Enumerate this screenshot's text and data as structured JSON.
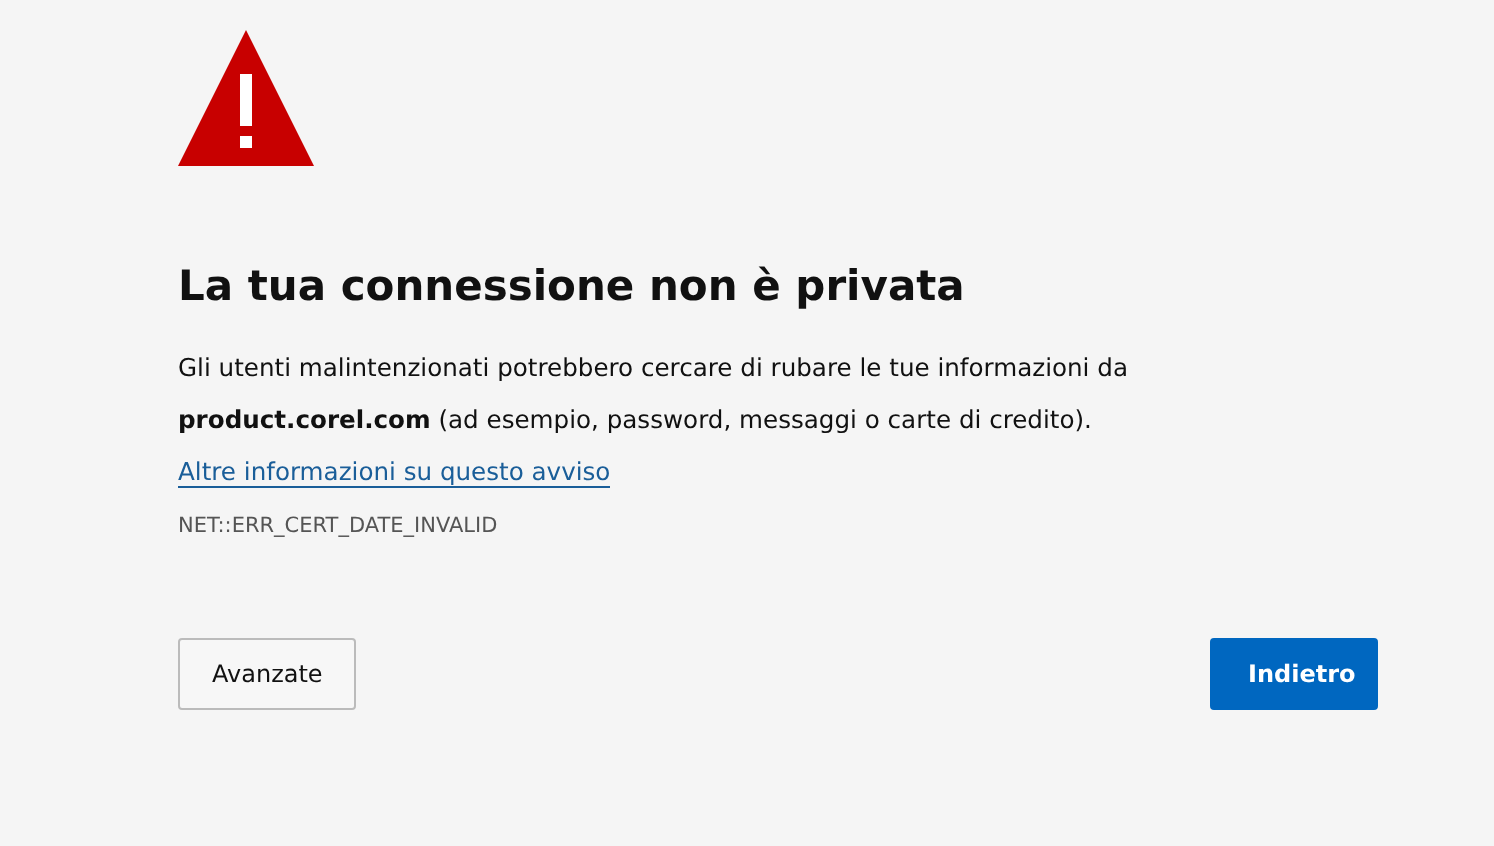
{
  "heading": "La tua connessione non è privata",
  "description": {
    "text": "Gli utenti malintenzionati potrebbero cercare di rubare le tue informazioni da **product.corel.com** (ad esempio, password, messaggi o carte di credito).",
    "link": "Altre informazioni su questo avviso"
  },
  "error_code": "NET::ERR_CERT_DATE_INVALID",
  "buttons": [
    {
      "label": "Avanzate",
      "kind": "secondary"
    },
    {
      "label": "Indietro",
      "kind": "primary"
    }
  ]
}
